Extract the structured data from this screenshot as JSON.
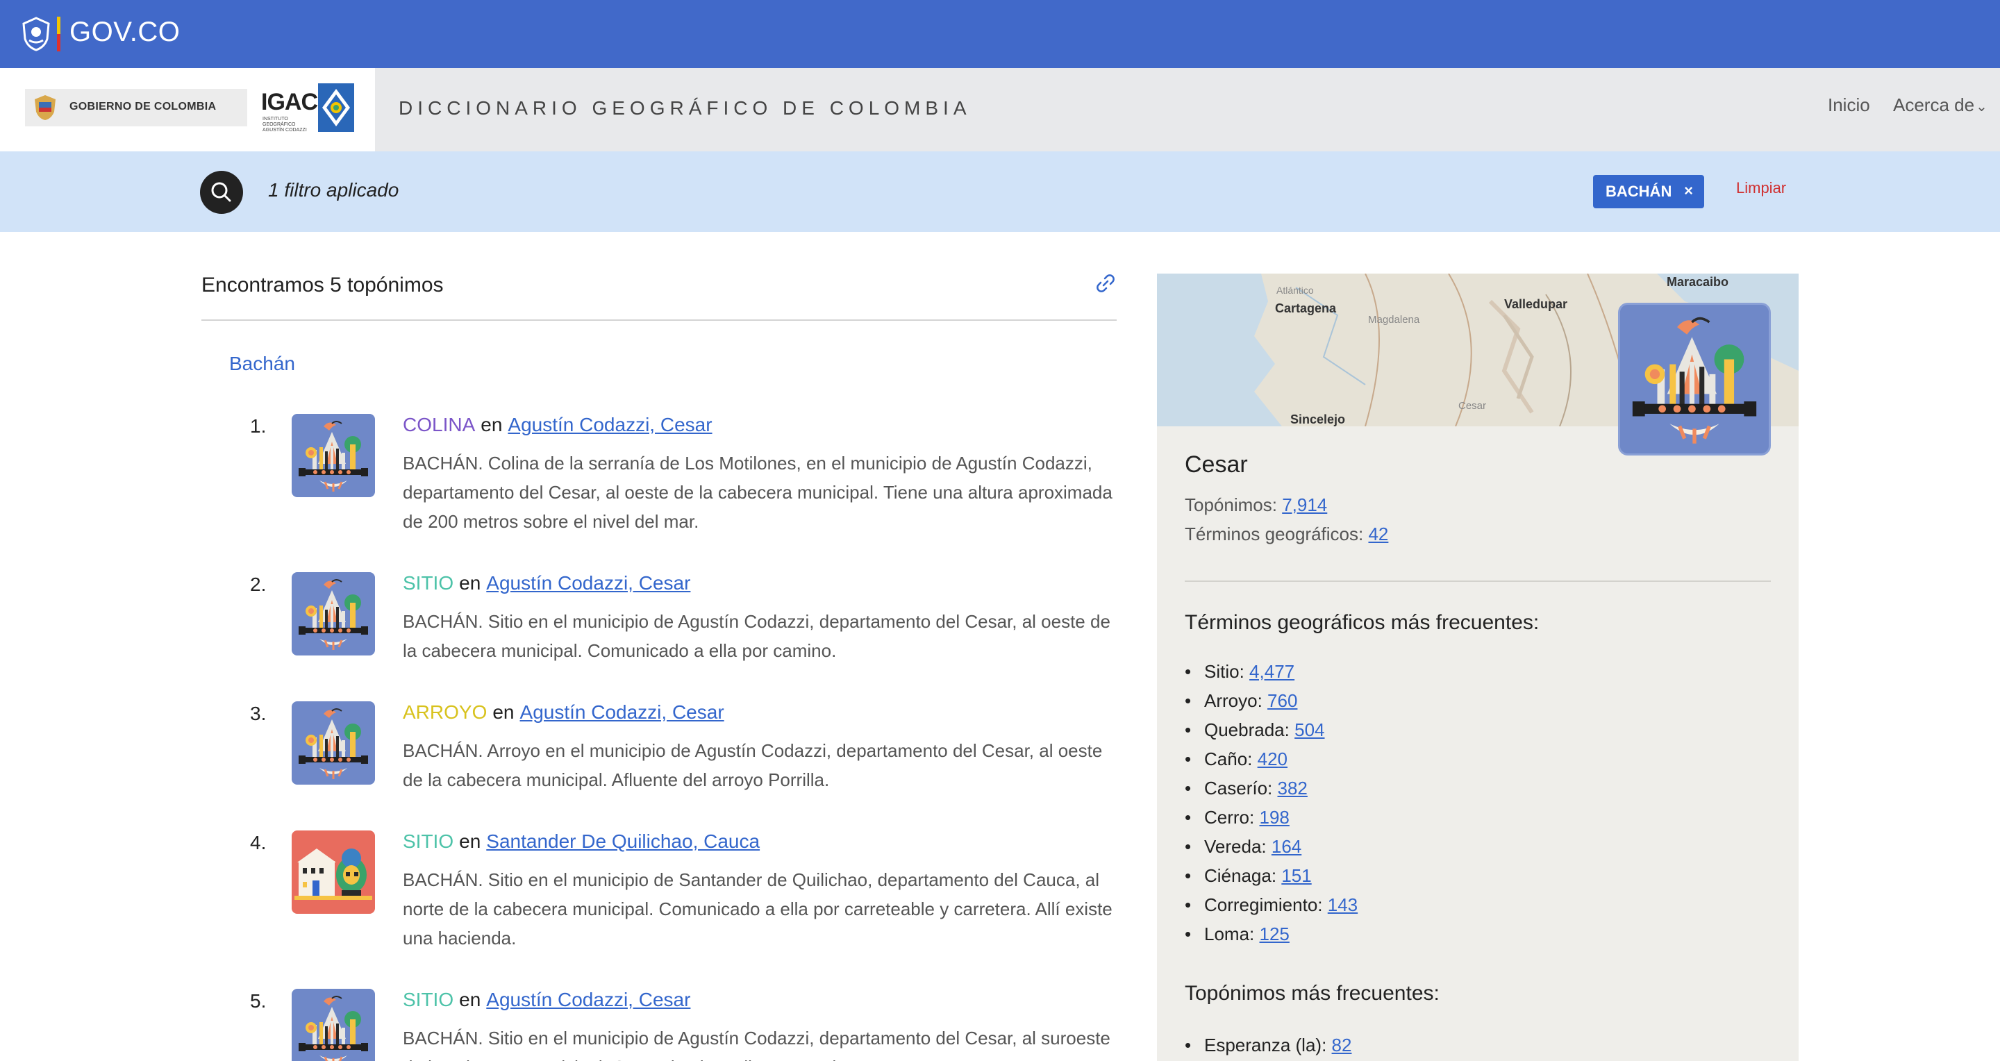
{
  "govbar": {
    "brand": "GOV.CO"
  },
  "header": {
    "gobierno_logo_text": "GOBIERNO DE COLOMBIA",
    "igac_logo_text": "IGAC",
    "igac_logo_subtext": "INSTITUTO GEOGRÁFICO AGUSTÍN CODAZZI",
    "site_title": "DICCIONARIO GEOGRÁFICO DE COLOMBIA",
    "nav": [
      {
        "label": "Inicio"
      },
      {
        "label": "Acerca de"
      }
    ]
  },
  "filterbar": {
    "label": "1 filtro aplicado",
    "chip_label": "BACHÁN",
    "chip_remove": "×",
    "clear_label": "Limpiar"
  },
  "results": {
    "title": "Encontramos 5 topónimos",
    "group_title": "Bachán",
    "en_word": "en",
    "items": [
      {
        "num": "1.",
        "type": "COLINA",
        "type_color": "#7b55c8",
        "location": "Agustín Codazzi, Cesar",
        "thumb": "cesar-illustration",
        "desc": "BACHÁN. Colina de la serranía de Los Motilones, en el municipio de Agustín Codazzi, departamento del Cesar, al oeste de la cabecera municipal. Tiene una altura aproximada de 200 metros sobre el nivel del mar."
      },
      {
        "num": "2.",
        "type": "SITIO",
        "type_color": "#4cc2a8",
        "location": "Agustín Codazzi, Cesar",
        "thumb": "cesar-illustration",
        "desc": "BACHÁN. Sitio en el municipio de Agustín Codazzi, departamento del Cesar, al oeste de la cabecera municipal. Comunicado a ella por camino."
      },
      {
        "num": "3.",
        "type": "ARROYO",
        "type_color": "#d8c21d",
        "location": "Agustín Codazzi, Cesar",
        "thumb": "cesar-illustration",
        "desc": "BACHÁN. Arroyo en el municipio de Agustín Codazzi, departamento del Cesar, al oeste de la cabecera municipal. Afluente del arroyo Porrilla."
      },
      {
        "num": "4.",
        "type": "SITIO",
        "type_color": "#4cc2a8",
        "location": "Santander De Quilichao, Cauca",
        "thumb": "cauca-illustration",
        "desc": "BACHÁN. Sitio en el municipio de Santander de Quilichao, departamento del Cauca, al norte de la cabecera municipal. Comunicado a ella por carreteable y carretera. Allí existe una hacienda."
      },
      {
        "num": "5.",
        "type": "SITIO",
        "type_color": "#4cc2a8",
        "location": "Agustín Codazzi, Cesar",
        "thumb": "cesar-illustration",
        "desc": "BACHÁN. Sitio en el municipio de Agustín Codazzi, departamento del Cesar, al suroeste de la cabecera municipal. Comunicado a ella por camino."
      }
    ]
  },
  "panel": {
    "map_labels": {
      "maracaibo": "Maracaibo",
      "atlantico": "Atlántico",
      "cartagena": "Cartagena",
      "valledupar": "Valledupar",
      "magdalena": "Magdalena",
      "sincelejo": "Sincelejo",
      "cesar": "Cesar"
    },
    "title": "Cesar",
    "toponimos_label": "Topónimos:",
    "toponimos_value": "7,914",
    "terminos_label": "Términos geográficos:",
    "terminos_value": "42",
    "frecuentes_title": "Términos geográficos más frecuentes:",
    "frecuentes": [
      {
        "label": "Sitio:",
        "value": "4,477"
      },
      {
        "label": "Arroyo:",
        "value": "760"
      },
      {
        "label": "Quebrada:",
        "value": "504"
      },
      {
        "label": "Caño:",
        "value": "420"
      },
      {
        "label": "Caserío:",
        "value": "382"
      },
      {
        "label": "Cerro:",
        "value": "198"
      },
      {
        "label": "Vereda:",
        "value": "164"
      },
      {
        "label": "Ciénaga:",
        "value": "151"
      },
      {
        "label": "Corregimiento:",
        "value": "143"
      },
      {
        "label": "Loma:",
        "value": "125"
      }
    ],
    "toponimos_frecuentes_title": "Topónimos más frecuentes:",
    "toponimos_frecuentes": [
      {
        "label": "Esperanza (la):",
        "value": "82"
      }
    ]
  }
}
